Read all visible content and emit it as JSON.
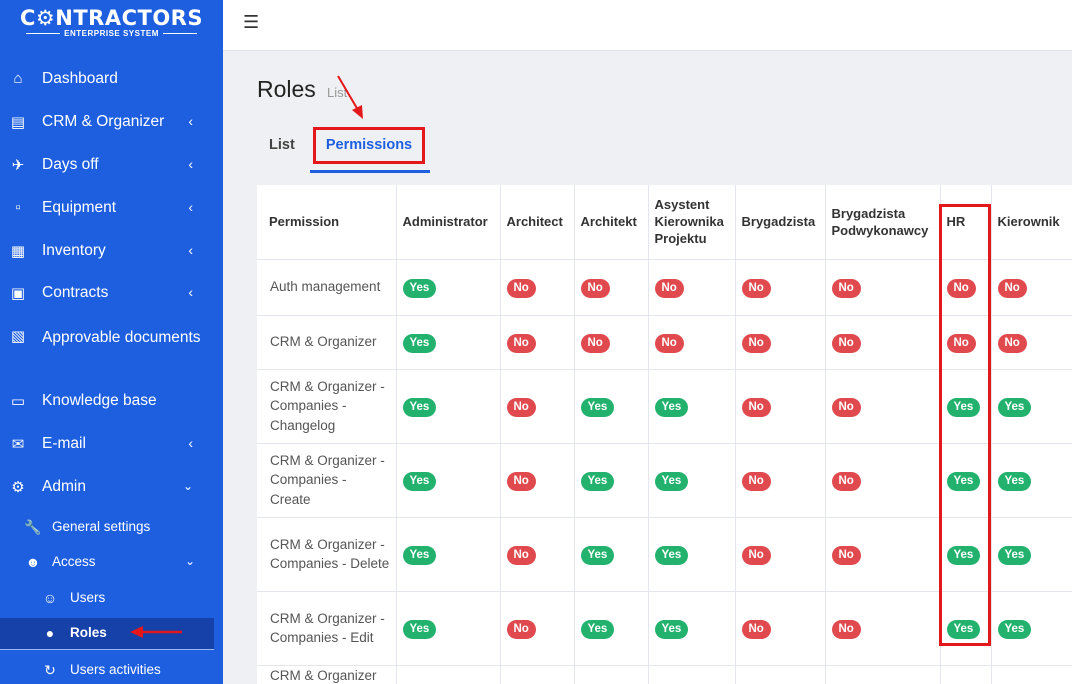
{
  "sidebar": {
    "logo_title": "C⚙NTRACTORS",
    "logo_subtitle": "ENTERPRISE SYSTEM",
    "items": [
      {
        "label": "Dashboard",
        "icon": "home-icon"
      },
      {
        "label": "CRM & Organizer",
        "icon": "id-card-icon"
      },
      {
        "label": "Days off",
        "icon": "plane-icon"
      },
      {
        "label": "Equipment",
        "icon": "hdd-icon"
      },
      {
        "label": "Inventory",
        "icon": "cubes-icon"
      },
      {
        "label": "Contracts",
        "icon": "briefcase-icon"
      },
      {
        "label": "Approvable documents",
        "icon": "file-icon"
      },
      {
        "label": "Knowledge base",
        "icon": "book-icon"
      },
      {
        "label": "E-mail",
        "icon": "envelope-icon"
      },
      {
        "label": "Admin",
        "icon": "cogs-icon"
      }
    ],
    "sub_items": [
      {
        "label": "General settings",
        "icon": "wrench-icon"
      },
      {
        "label": "Access",
        "icon": "users-icon"
      },
      {
        "label": "Users",
        "icon": "user-plus-icon"
      },
      {
        "label": "Roles",
        "icon": "user-icon"
      },
      {
        "label": "Users activities",
        "icon": "history-icon"
      }
    ]
  },
  "page": {
    "title": "Roles",
    "subtitle": "List"
  },
  "tabs": {
    "list": "List",
    "permissions": "Permissions"
  },
  "table": {
    "headers": [
      "Permission",
      "Administrator",
      "Architect",
      "Architekt",
      "Asystent Kierownika Projektu",
      "Brygadzista",
      "Brygadzista Podwykonawcy",
      "HR",
      "Kierownik"
    ],
    "rows": [
      {
        "permission": "Auth management",
        "values": [
          "Yes",
          "No",
          "No",
          "No",
          "No",
          "No",
          "No",
          "No"
        ]
      },
      {
        "permission": "CRM & Organizer",
        "values": [
          "Yes",
          "No",
          "No",
          "No",
          "No",
          "No",
          "No",
          "No"
        ]
      },
      {
        "permission": "CRM & Organizer - Companies - Changelog",
        "values": [
          "Yes",
          "No",
          "Yes",
          "Yes",
          "No",
          "No",
          "Yes",
          "Yes"
        ]
      },
      {
        "permission": "CRM & Organizer - Companies - Create",
        "values": [
          "Yes",
          "No",
          "Yes",
          "Yes",
          "No",
          "No",
          "Yes",
          "Yes"
        ]
      },
      {
        "permission": "CRM & Organizer - Companies - Delete",
        "values": [
          "Yes",
          "No",
          "Yes",
          "Yes",
          "No",
          "No",
          "Yes",
          "Yes"
        ]
      },
      {
        "permission": "CRM & Organizer - Companies - Edit",
        "values": [
          "Yes",
          "No",
          "Yes",
          "Yes",
          "No",
          "No",
          "Yes",
          "Yes"
        ]
      },
      {
        "permission": "CRM & Organizer",
        "values": []
      }
    ]
  },
  "colors": {
    "sidebar_bg": "#1e5fe0",
    "active_bg": "#1541a8",
    "yes": "#22b26d",
    "no": "#e04a4e",
    "annotation": "#e4181b"
  }
}
